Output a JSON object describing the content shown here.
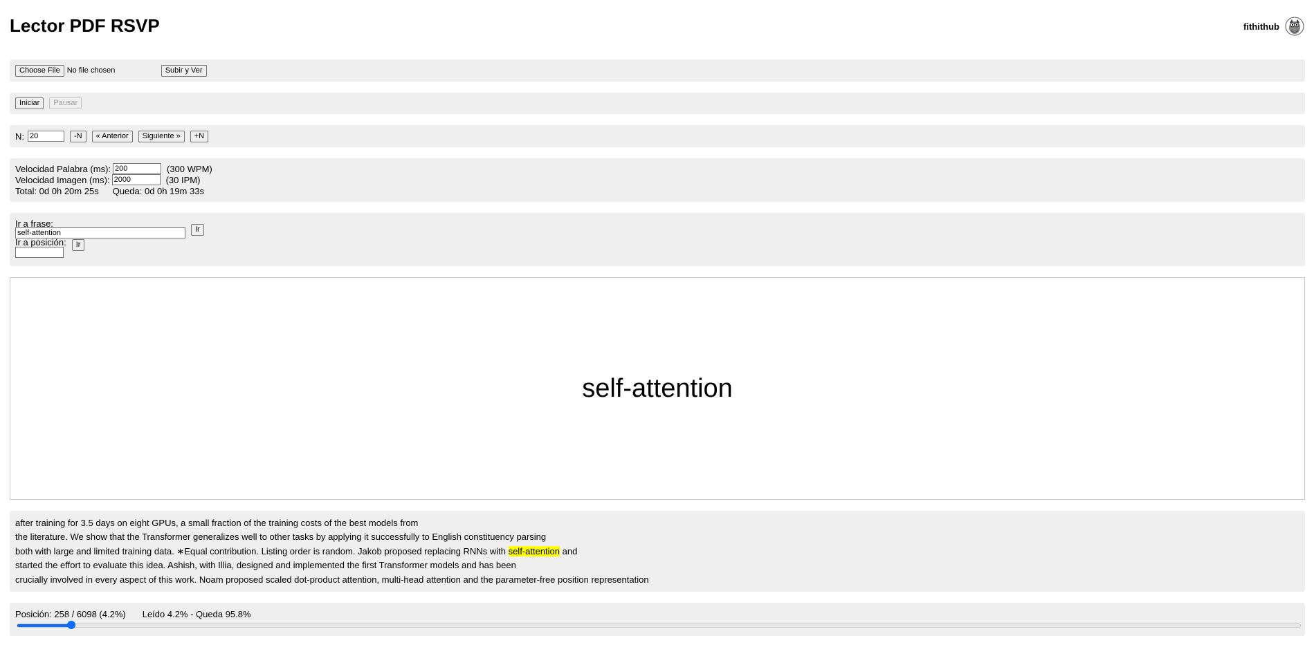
{
  "header": {
    "title": "Lector PDF RSVP",
    "username": "fithithub",
    "avatar_icon": "owl-avatar-icon"
  },
  "upload": {
    "choose_label": "Choose File",
    "file_status": "No file chosen",
    "submit_label": "Subir y Ver"
  },
  "playback": {
    "start_label": "Iniciar",
    "pause_label": "Pausar"
  },
  "navigation": {
    "n_label": "N:",
    "n_value": "20",
    "minus_n_label": "-N",
    "prev_label": "« Anterior",
    "next_label": "Siguiente »",
    "plus_n_label": "+N"
  },
  "speed": {
    "word_label": "Velocidad Palabra (ms):",
    "word_value": "200",
    "word_rate": "(300 WPM)",
    "image_label": "Velocidad Imagen (ms):",
    "image_value": "2000",
    "image_rate": "(30 IPM)",
    "total_text": "Total: 0d 0h 20m 25s",
    "remaining_text": "Queda: 0d 0h 19m 33s"
  },
  "goto": {
    "phrase_label": "Ir a frase:",
    "phrase_value": "self-attention",
    "phrase_button": "Ir",
    "position_label": "Ir a posición:",
    "position_value": "",
    "position_button": "Ir"
  },
  "display": {
    "current_word": "self-attention"
  },
  "context": {
    "line1": "after training for 3.5 days on eight GPUs, a small fraction of the training costs of the best models from",
    "line2": "the literature. We show that the Transformer generalizes well to other tasks by applying it successfully to English constituency parsing",
    "line3_before": "both with large and limited training data. ∗Equal contribution. Listing order is random. Jakob proposed replacing RNNs with",
    "line3_highlight": "self-attention",
    "line3_after": "and",
    "line4": "started the effort to evaluate this idea. Ashish, with Illia, designed and implemented the first Transformer models and has been",
    "line5": "crucially involved in every aspect of this work. Noam proposed scaled dot-product attention, multi-head attention and the parameter-free position representation"
  },
  "progress": {
    "position_text": "Posición: 258 / 6098 (4.2%)",
    "read_text": "Leído 4.2% - Queda 95.8%",
    "fraction": 0.042,
    "accent_color": "#0d6efd"
  }
}
